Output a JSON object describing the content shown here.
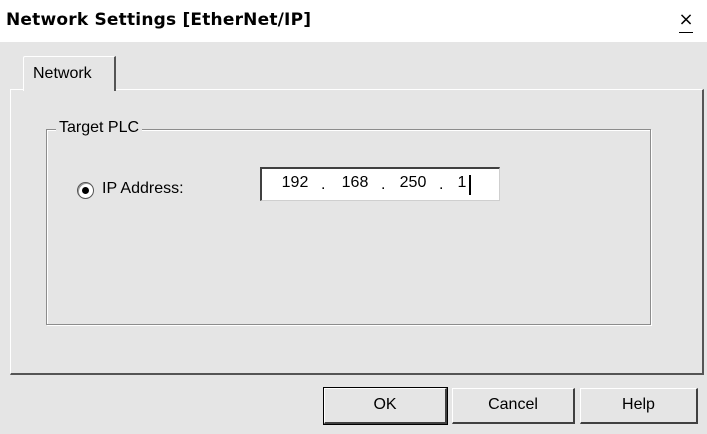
{
  "window": {
    "title": "Network Settings [EtherNet/IP]",
    "close_glyph": "×"
  },
  "tabs": [
    {
      "label": "Network",
      "active": true
    }
  ],
  "target_plc": {
    "group_label": "Target PLC",
    "mode": {
      "label": "IP Address:",
      "selected": true
    },
    "ip_address": {
      "octets": [
        "192",
        "168",
        "250",
        "1"
      ],
      "separator": "."
    }
  },
  "buttons": {
    "ok": "OK",
    "cancel": "Cancel",
    "help": "Help"
  },
  "colors": {
    "face": "#e5e5e5",
    "highlight": "#ffffff",
    "shadow": "#404040"
  }
}
